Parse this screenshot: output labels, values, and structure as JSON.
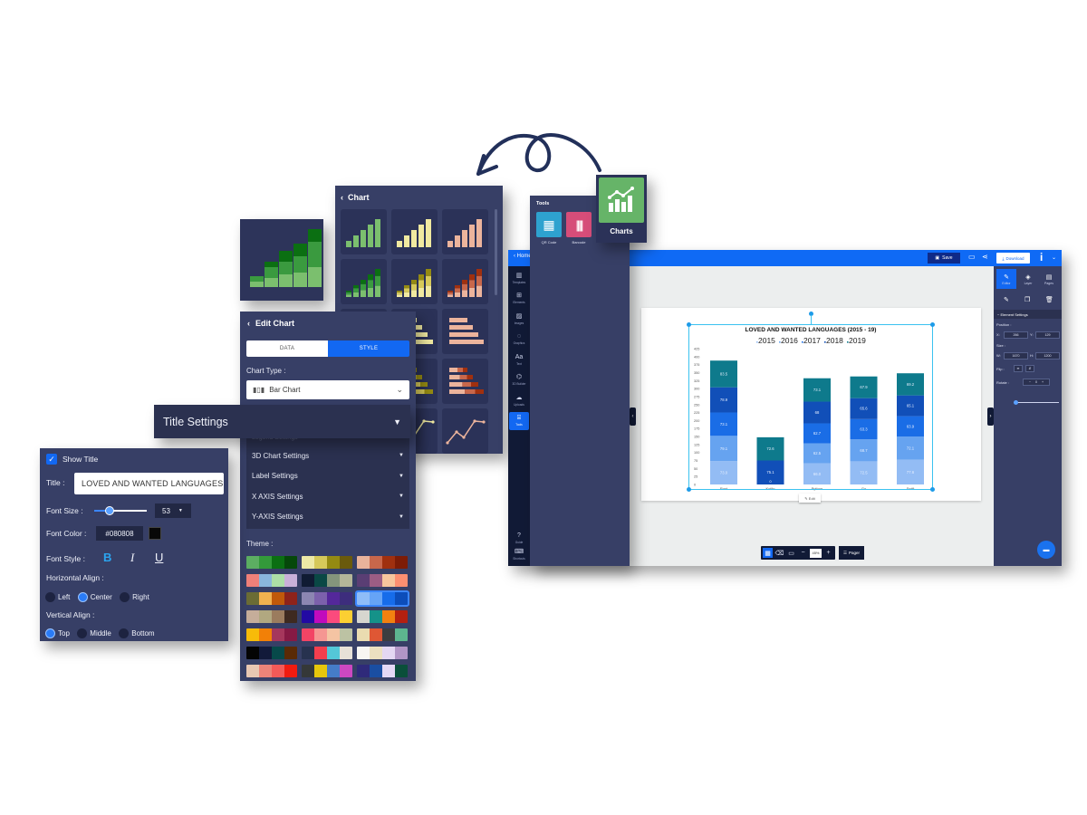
{
  "colors": {
    "accent": "#1268f2",
    "panel": "#373f66",
    "panel_dark": "#2b3150",
    "nav_dark": "#111a36",
    "charts_tile": "#66b468"
  },
  "chart_picker": {
    "title": "Chart",
    "back_icon": "chevron-left-icon",
    "tiles": [
      {
        "kind": "bar",
        "palette": "green"
      },
      {
        "kind": "bar",
        "palette": "yellow"
      },
      {
        "kind": "bar",
        "palette": "peach"
      },
      {
        "kind": "stacked-bar",
        "palette": "green"
      },
      {
        "kind": "stacked-bar",
        "palette": "yellow"
      },
      {
        "kind": "stacked-bar",
        "palette": "peach"
      },
      {
        "kind": "horizontal-bar",
        "palette": "green"
      },
      {
        "kind": "horizontal-bar",
        "palette": "yellow"
      },
      {
        "kind": "horizontal-bar",
        "palette": "peach"
      },
      {
        "kind": "stacked-horizontal-bar",
        "palette": "green"
      },
      {
        "kind": "stacked-horizontal-bar",
        "palette": "yellow"
      },
      {
        "kind": "stacked-horizontal-bar",
        "palette": "peach"
      },
      {
        "kind": "line",
        "palette": "green"
      },
      {
        "kind": "line",
        "palette": "yellow"
      },
      {
        "kind": "line",
        "palette": "peach"
      }
    ]
  },
  "edit_chart": {
    "title": "Edit Chart",
    "tabs": [
      {
        "label": "DATA",
        "active": false
      },
      {
        "label": "STYLE",
        "active": true
      }
    ],
    "chart_type_label": "Chart Type :",
    "chart_type_value": "Bar Chart",
    "settings": [
      {
        "label": "Legend Settings"
      },
      {
        "label": "3D Chart Settings"
      },
      {
        "label": "Label Settings"
      },
      {
        "label": "X AXIS Settings"
      },
      {
        "label": "Y-AXIS Settings"
      }
    ],
    "theme_label": "Theme :",
    "themes": [
      [
        "#5cae62",
        "#339a3a",
        "#0b6f12",
        "#06480a"
      ],
      [
        "#ede9a6",
        "#d6c95a",
        "#948a12",
        "#6a5a0c"
      ],
      [
        "#e9b39b",
        "#c8674b",
        "#a0300f",
        "#7d1c06"
      ],
      [
        "#f08079",
        "#8ab6dc",
        "#acdfa6",
        "#c9b0d8"
      ],
      [
        "#101b33",
        "#0a4845",
        "#84957c",
        "#b4b699"
      ],
      [
        "#5a3e74",
        "#9c5d84",
        "#f7c59d",
        "#fd8f71"
      ],
      [
        "#6b6c35",
        "#f0b14f",
        "#c0590a",
        "#8e231a"
      ],
      [
        "#8c86b2",
        "#7c61ac",
        "#54289b",
        "#3d2d7d"
      ],
      [
        "#8fbcf8",
        "#66a4f6",
        "#166cea",
        "#0c4dba"
      ],
      [
        "#c5ad9a",
        "#b1a880",
        "#9b7c5e",
        "#3e2a20"
      ],
      [
        "#220aa3",
        "#c10bbd",
        "#fb4b7d",
        "#fccf32"
      ],
      [
        "#d6d6cf",
        "#159289",
        "#f28110",
        "#b42010"
      ],
      [
        "#f7bb09",
        "#f28007",
        "#a5375c",
        "#861a44"
      ],
      [
        "#f34465",
        "#f59692",
        "#f4c4a3",
        "#bcc2a3"
      ],
      [
        "#eadcb0",
        "#df5734",
        "#3c3e40",
        "#5db68f"
      ],
      [
        "#040404",
        "#121a3a",
        "#07494a",
        "#5a2a06"
      ],
      [
        "#27324f",
        "#f43e4e",
        "#54c7d8",
        "#e7e1d8"
      ],
      [
        "#f8f6f2",
        "#ece0c0",
        "#e4d7f2",
        "#b195c6"
      ],
      [
        "#e8c7b2",
        "#ec8479",
        "#f45a58",
        "#f11b10"
      ],
      [
        "#353838",
        "#e6c60c",
        "#457cc8",
        "#cc48c1"
      ],
      [
        "#2f2a7a",
        "#1a4ea2",
        "#e4d8f5",
        "#0a4f3a"
      ]
    ],
    "selected_theme": 8
  },
  "title_settings": {
    "header": "Title Settings",
    "show_title_label": "Show Title",
    "show_title_checked": true,
    "title_label": "Title :",
    "title_value": "LOVED AND WANTED LANGUAGES (2015 - 19)",
    "font_size_label": "Font Size :",
    "font_size_value": "53",
    "font_size_slider": 0.3,
    "font_color_label": "Font Color :",
    "font_color_value": "#080808",
    "font_style_label": "Font Style :",
    "font_style_buttons": [
      {
        "label": "B",
        "name": "bold",
        "active": true
      },
      {
        "label": "I",
        "name": "italic",
        "active": false
      },
      {
        "label": "U",
        "name": "underline",
        "active": false
      }
    ],
    "h_align_label": "Horizontal Align :",
    "h_align_options": [
      {
        "label": "Left",
        "selected": false
      },
      {
        "label": "Center",
        "selected": true
      },
      {
        "label": "Right",
        "selected": false
      }
    ],
    "v_align_label": "Vertical Align :",
    "v_align_options": [
      {
        "label": "Top",
        "selected": true
      },
      {
        "label": "Middle",
        "selected": false
      },
      {
        "label": "Bottom",
        "selected": false
      }
    ]
  },
  "tools_popup": {
    "title": "Tools",
    "items": [
      {
        "label": "QR Code",
        "icon": "qr-code-icon",
        "color": "#2ea2cf"
      },
      {
        "label": "Barcode",
        "icon": "barcode-icon",
        "color": "#d64d79"
      }
    ],
    "charts_label": "Charts"
  },
  "app": {
    "back_label": "Home",
    "save_label": "Save",
    "download_label": "Download",
    "left_nav": [
      {
        "label": "Templates",
        "icon": "▥"
      },
      {
        "label": "Elements",
        "icon": "⊞"
      },
      {
        "label": "Images",
        "icon": "▨"
      },
      {
        "label": "Graphics",
        "icon": "◌"
      },
      {
        "label": "Text",
        "icon": "Aa"
      },
      {
        "label": "3D Builder",
        "icon": "⌬"
      },
      {
        "label": "Uploads",
        "icon": "☁"
      },
      {
        "label": "Tools",
        "icon": "⌸",
        "active": true
      }
    ],
    "left_nav_bottom": [
      {
        "label": "Guide",
        "icon": "?"
      },
      {
        "label": "Shortcuts",
        "icon": "⌨"
      }
    ],
    "right_tabs": [
      {
        "label": "Editor",
        "icon": "✎",
        "active": true
      },
      {
        "label": "Layer",
        "icon": "◈",
        "active": false
      },
      {
        "label": "Pages",
        "icon": "▤",
        "active": false
      }
    ],
    "element_settings_label": "Element Settings",
    "position_label": "Position :",
    "position_x": "266",
    "position_y": "129",
    "size_label": "Size :",
    "size_w": "1670",
    "size_h": "1200",
    "flip_label": "Flip :",
    "rotate_label": "Rotate :",
    "rotate_value": "0",
    "edit_label": "Edit",
    "zoom_value": "45%",
    "pager_label": "Pager"
  },
  "chart_data": {
    "type": "bar",
    "stacked": true,
    "title": "LOVED AND WANTED LANGUAGES (2015 - 19)",
    "categories": [
      "Rust",
      "Kotlin",
      "Python",
      "Go",
      "Swift"
    ],
    "legend": [
      "2015",
      "2016",
      "2017",
      "2018",
      "2019"
    ],
    "legend_position": "top-center",
    "series": [
      {
        "name": "2015",
        "color": "#93bcf4",
        "values": [
          73.0,
          0,
          66.0,
          72.5,
          77.6
        ]
      },
      {
        "name": "2016",
        "color": "#66a3f0",
        "values": [
          79.1,
          0,
          62.5,
          68.7,
          72.1
        ]
      },
      {
        "name": "2017",
        "color": "#1a6de6",
        "values": [
          73.1,
          0,
          62.7,
          63.3,
          63.9
        ]
      },
      {
        "name": "2018",
        "color": "#114fb8",
        "values": [
          78.9,
          75.1,
          68.0,
          65.6,
          65.1
        ]
      },
      {
        "name": "2019",
        "color": "#0e7a8c",
        "values": [
          83.5,
          72.6,
          73.1,
          67.9,
          69.2
        ]
      }
    ],
    "data_labels": [
      [
        "73.0",
        "79.1",
        "73.1",
        "78.9",
        "83.5"
      ],
      [
        "",
        "",
        "",
        "75.1",
        "72.6"
      ],
      [
        "66.0",
        "62.5",
        "62.7",
        "68",
        "73.1"
      ],
      [
        "72.5",
        "68.7",
        "63.3",
        "65.6",
        "67.9"
      ],
      [
        "77.6",
        "72.1",
        "63.9",
        "65.1",
        "69.2"
      ]
    ],
    "kotlin_zero_label": "0",
    "ylim": [
      0,
      425
    ],
    "yticks": [
      "0",
      "25",
      "50",
      "75",
      "100",
      "125",
      "150",
      "175",
      "200",
      "225",
      "250",
      "275",
      "300",
      "325",
      "350",
      "375",
      "400",
      "425"
    ],
    "xlabel": "",
    "ylabel": "",
    "grid": false
  }
}
